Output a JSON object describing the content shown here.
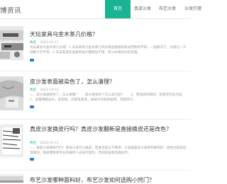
{
  "header": {
    "logo": "博资讯"
  },
  "nav": {
    "items": [
      {
        "label": "首页",
        "active": true
      },
      {
        "label": "真皮沙发"
      },
      {
        "label": "布艺沙发"
      },
      {
        "label": "沙发打理"
      }
    ]
  },
  "articles": [
    {
      "title": "天坛家具乌金木茶几价格？",
      "author": "佚名",
      "date": "2023-10-11",
      "summary": "天坛家具乌金木茶几价格？1.天坛家具乌金木茶几的价格因规格和款式而有所不同。一般情况下，价格在一千到数千元不等。2.天坛家具的品质和设计都相当不错，所以价格也比较合理。"
    },
    {
      "title": "皮沙发表面被染色了，怎么清理？",
      "author": "佚名",
      "date": "2023-10-11",
      "summary": "一、皮沙发被染色了，怎么清理？　　皮沙发染色了怎么去污迹？　　1、用湿抹布擦拭，加清洁剂去污迹。2、适量用肥皂水、洗衣粉、白醋等清洗，除掉污渍和残留物，然后晾干。"
    },
    {
      "title": "真皮沙发换皮行吗？真皮沙发翻新是直接换皮还是改色？",
      "author": "佚名",
      "date": "2023-10-11",
      "summary": "一、真皮沙发换皮行吗？真皮沙发可以换皮，但要注意以下事项：沙发底座及沙发结构要完好，避免出现松动等情况；换皮需要请专业的维修人员进行操作，否则很容易造成损坏。"
    },
    {
      "title": "布艺沙发哪种面料好，布艺沙发如何选购小窍门？",
      "author": "佚名",
      "date": "2023-10-11",
      "summary": ""
    }
  ]
}
